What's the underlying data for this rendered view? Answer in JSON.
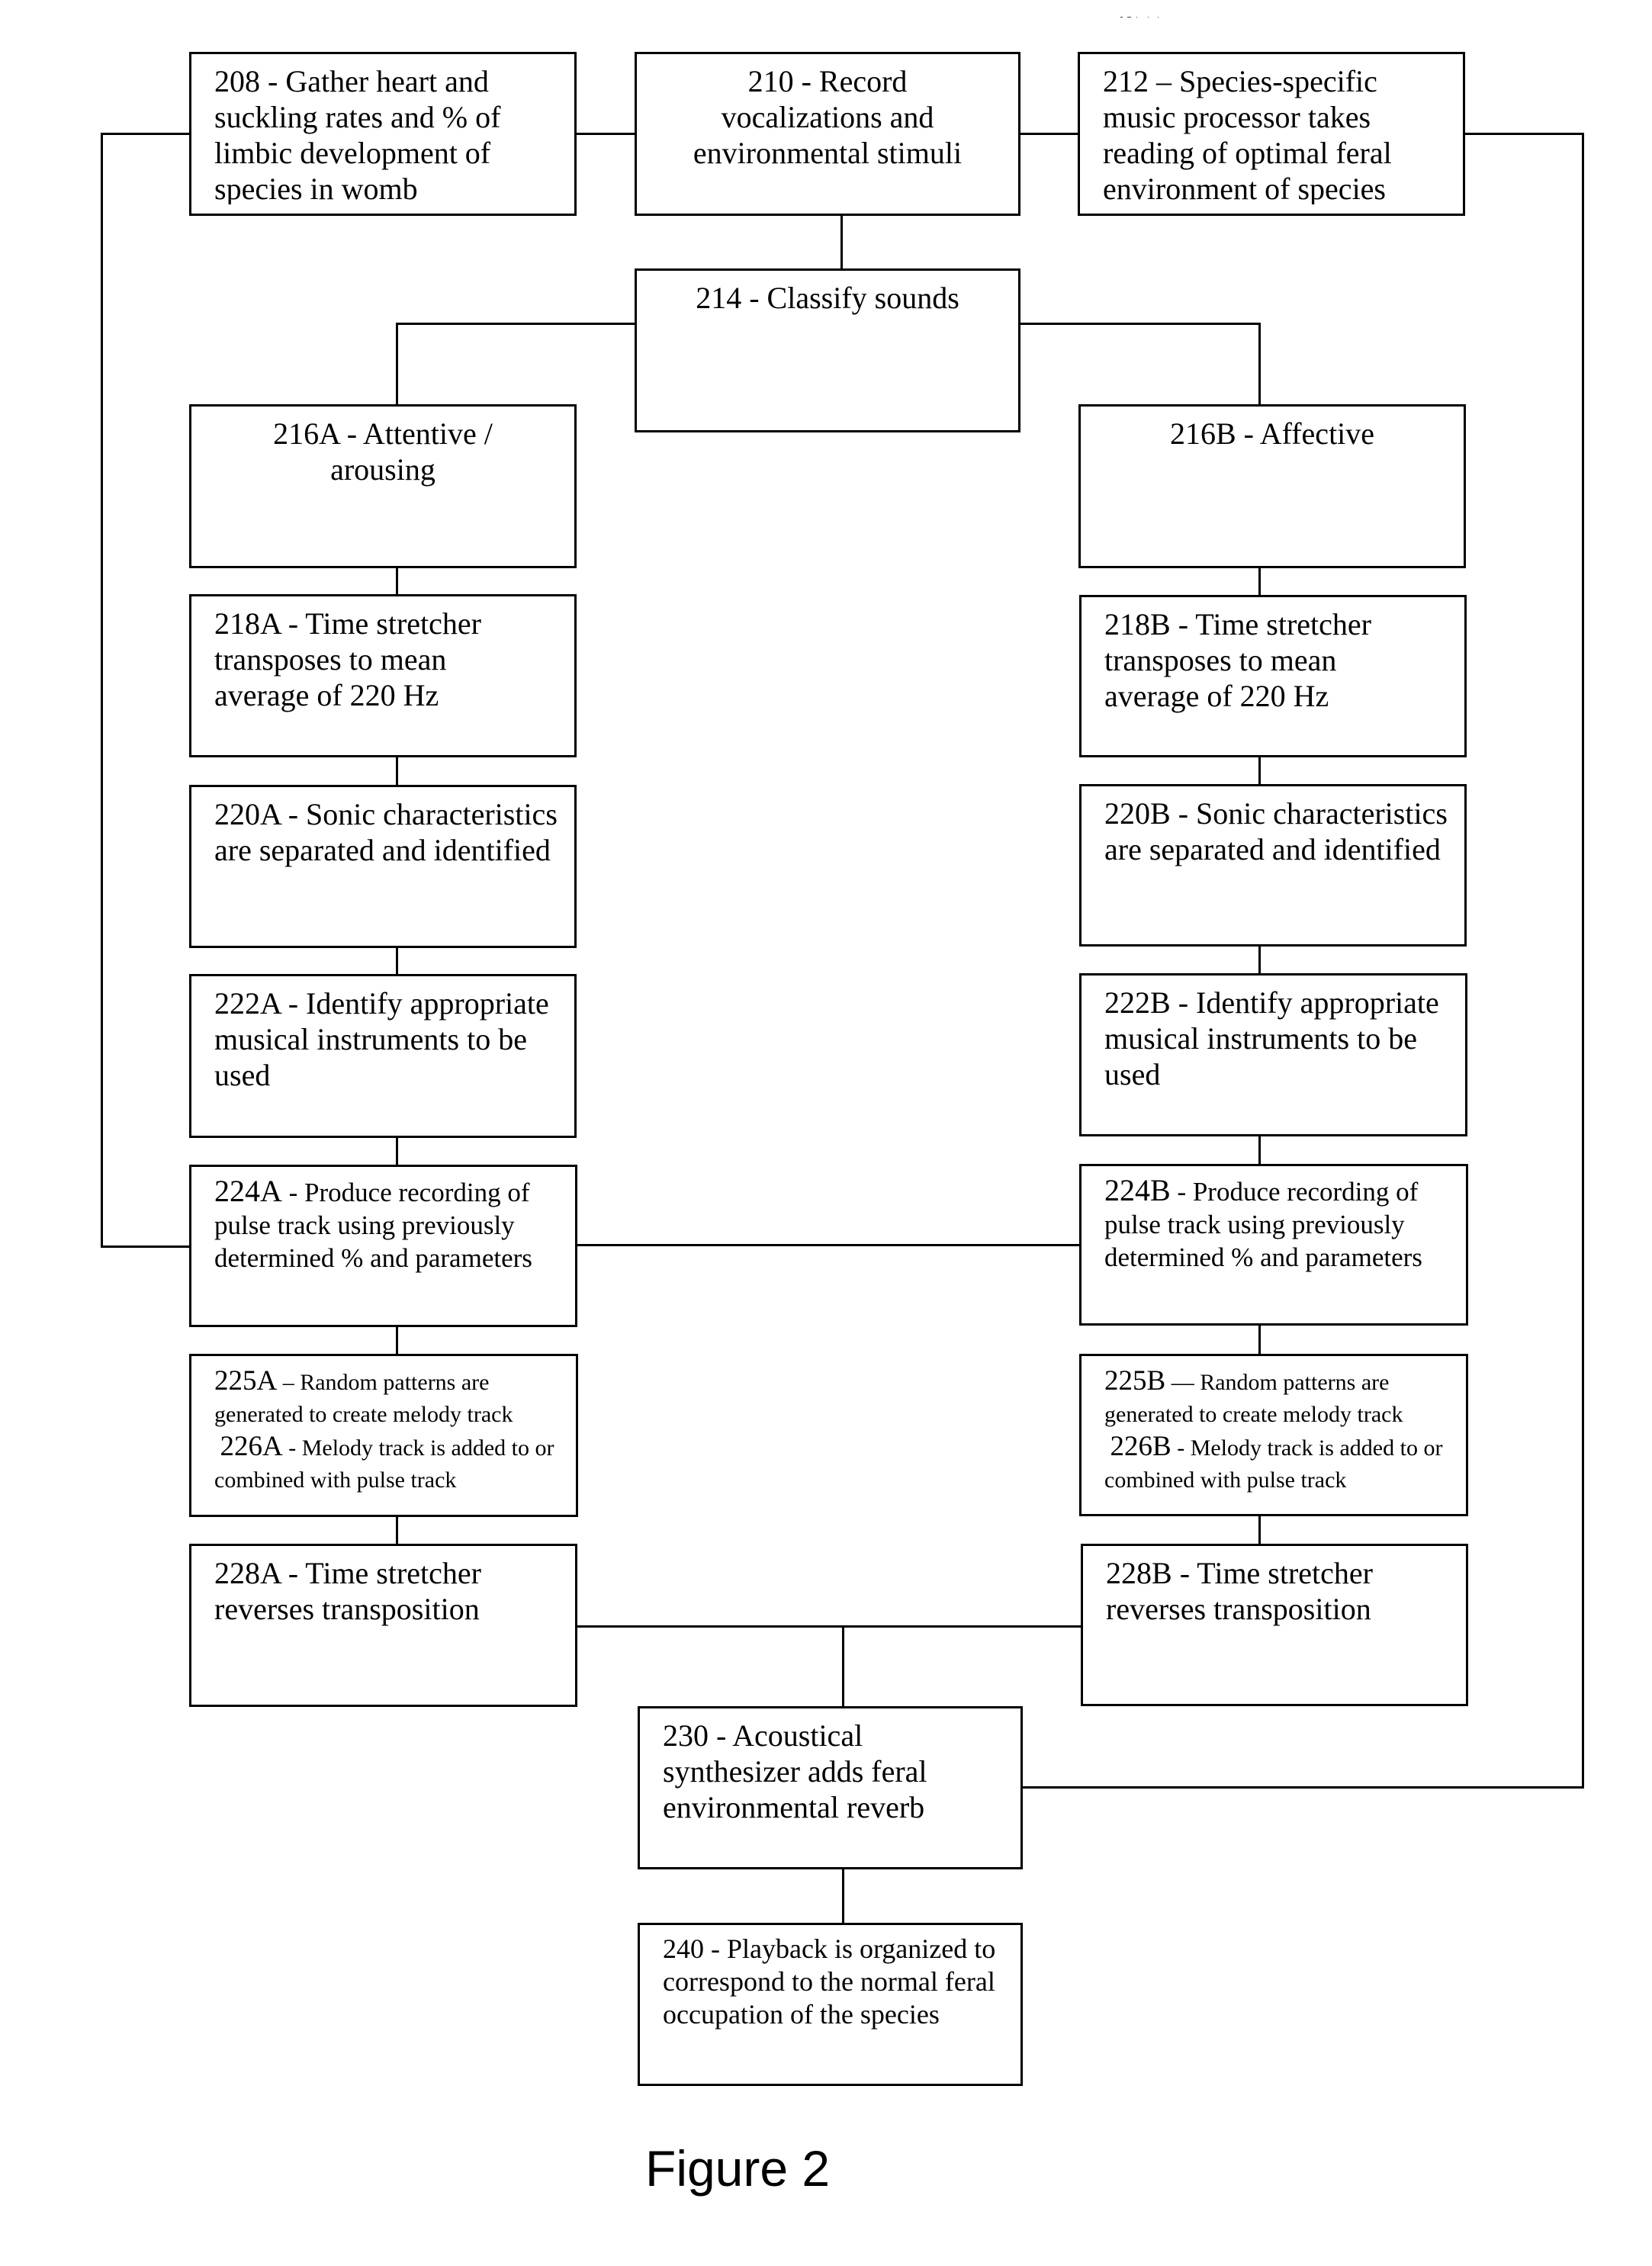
{
  "figure": {
    "label": "Figure 2",
    "border_color": "#000000",
    "background_color": "#ffffff"
  },
  "boxes": {
    "b208": {
      "num": "208",
      "sep": " - ",
      "text": "Gather heart and suckling rates and % of limbic development of species in womb"
    },
    "b210": {
      "num": "210",
      "sep": " - ",
      "text": "Record vocalizations and environmental stimuli"
    },
    "b212": {
      "num": "212",
      "sep": " – ",
      "text": "Species-specific music processor takes reading of optimal feral environment of species"
    },
    "b214": {
      "num": "214",
      "sep": " - ",
      "text": "Classify sounds"
    },
    "b216A": {
      "num": "216A",
      "sep": " - ",
      "text": "Attentive / arousing"
    },
    "b216B": {
      "num": "216B",
      "sep": " - ",
      "text": "Affective"
    },
    "b218A": {
      "num": "218A",
      "sep": " - ",
      "text": "Time stretcher transposes to mean average of 220 Hz"
    },
    "b218B": {
      "num": "218B",
      "sep": " - ",
      "text": "Time stretcher transposes to mean average of 220 Hz"
    },
    "b220A": {
      "num": "220A",
      "sep": " - ",
      "text": "Sonic characteristics are separated and identified"
    },
    "b220B": {
      "num": "220B",
      "sep": " - ",
      "text": "Sonic characteristics are separated and identified"
    },
    "b222A": {
      "num": "222A",
      "sep": " - ",
      "text": "Identify appropriate musical instruments to be used"
    },
    "b222B": {
      "num": "222B",
      "sep": " - ",
      "text": "Identify appropriate musical instruments to be used"
    },
    "b224A": {
      "num": "224A",
      "sep": " - ",
      "text": "Produce recording of pulse track using previously determined % and parameters"
    },
    "b224B": {
      "num": "224B",
      "sep": " - ",
      "text": "Produce recording of pulse track using previously determined % and parameters"
    },
    "b225A": {
      "num": "225A",
      "sep": " – ",
      "text": "Random patterns are generated to create melody track",
      "num2": "226A",
      "sep2": " - ",
      "text2": "Melody track is added to or combined with pulse track"
    },
    "b225B": {
      "num": "225B",
      "sep": " — ",
      "text": "Random patterns are generated to create melody track",
      "num2": "226B",
      "sep2": " - ",
      "text2": "Melody track is added to or combined with pulse track"
    },
    "b228A": {
      "num": "228A",
      "sep": " - ",
      "text": "Time stretcher reverses transposition"
    },
    "b228B": {
      "num": "228B",
      "sep": " - ",
      "text": "Time stretcher reverses transposition"
    },
    "b230": {
      "num": "230",
      "sep": " - ",
      "text": "Acoustical synthesizer adds feral environmental reverb"
    },
    "b240": {
      "num": "240",
      "sep": " - ",
      "text": "Playback is organized to correspond to the normal feral occupation of the species"
    }
  }
}
